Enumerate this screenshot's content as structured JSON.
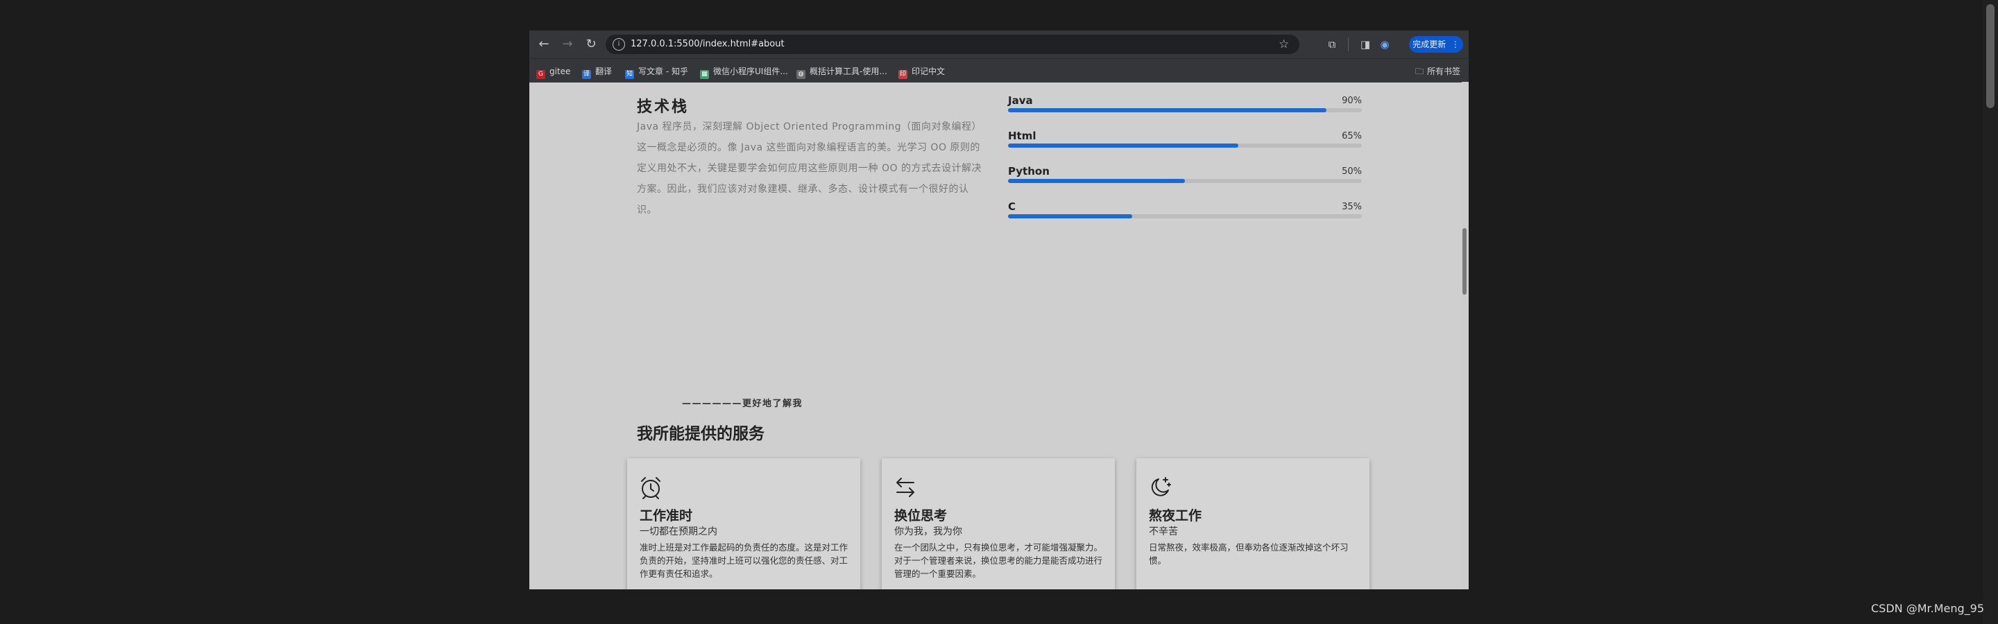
{
  "browser": {
    "url": "127.0.0.1:5500/index.html#about",
    "update_label": "完成更新",
    "bookmarks": [
      {
        "label": "gitee",
        "icon": "gitee-icon",
        "color": "#c71d23",
        "glyph": "G"
      },
      {
        "label": "翻译",
        "icon": "translate-icon",
        "color": "#2a6fd6",
        "glyph": "译"
      },
      {
        "label": "写文章 - 知乎",
        "icon": "zhihu-icon",
        "color": "#1772f6",
        "glyph": "知"
      },
      {
        "label": "微信小程序UI组件...",
        "icon": "grid-icon",
        "color": "#3ba272",
        "glyph": "▦"
      },
      {
        "label": "概括计算工具-使用...",
        "icon": "globe-icon",
        "color": "#6b6b6b",
        "glyph": "◍"
      },
      {
        "label": "印记中文",
        "icon": "yinji-icon",
        "color": "#d13b3b",
        "glyph": "印"
      }
    ],
    "all_bookmarks_label": "所有书签"
  },
  "tech": {
    "title": "技术栈",
    "description": "Java 程序员，深刻理解 Object Oriented Programming（面向对象编程）这一概念是必须的。像 Java 这些面向对象编程语言的美。光学习 OO 原则的定义用处不大，关键是要学会如何应用这些原则用一种 OO 的方式去设计解决方案。因此，我们应该对对象建模、继承、多态、设计模式有一个很好的认识。",
    "skills": [
      {
        "name": "Java",
        "percent_label": "90%",
        "level": 0.9
      },
      {
        "name": "Html",
        "percent_label": "65%",
        "level": 0.65
      },
      {
        "name": "Python",
        "percent_label": "50%",
        "level": 0.5
      },
      {
        "name": "C",
        "percent_label": "35%",
        "level": 0.35
      }
    ],
    "accent_color": "#1a6ad6"
  },
  "services": {
    "eyebrow": "——————更好地了解我",
    "title": "我所能提供的服务",
    "cards": [
      {
        "icon": "alarm-clock-icon",
        "title": "工作准时",
        "subtitle": "一切都在预期之内",
        "desc": "准时上班是对工作最起码的负责任的态度。这是对工作负责的开始，坚持准时上班可以强化您的责任感、对工作更有责任和追求。"
      },
      {
        "icon": "swap-arrows-icon",
        "title": "换位思考",
        "subtitle": "你为我，我为你",
        "desc": "在一个团队之中，只有换位思考，才可能增强凝聚力。对于一个管理者来说，换位思考的能力是能否成功进行管理的一个重要因素。"
      },
      {
        "icon": "moon-stars-icon",
        "title": "熬夜工作",
        "subtitle": "不辛苦",
        "desc": "日常熬夜，效率极高，但奉劝各位逐渐改掉这个坏习惯。"
      }
    ]
  },
  "watermark": "CSDN @Mr.Meng_95"
}
